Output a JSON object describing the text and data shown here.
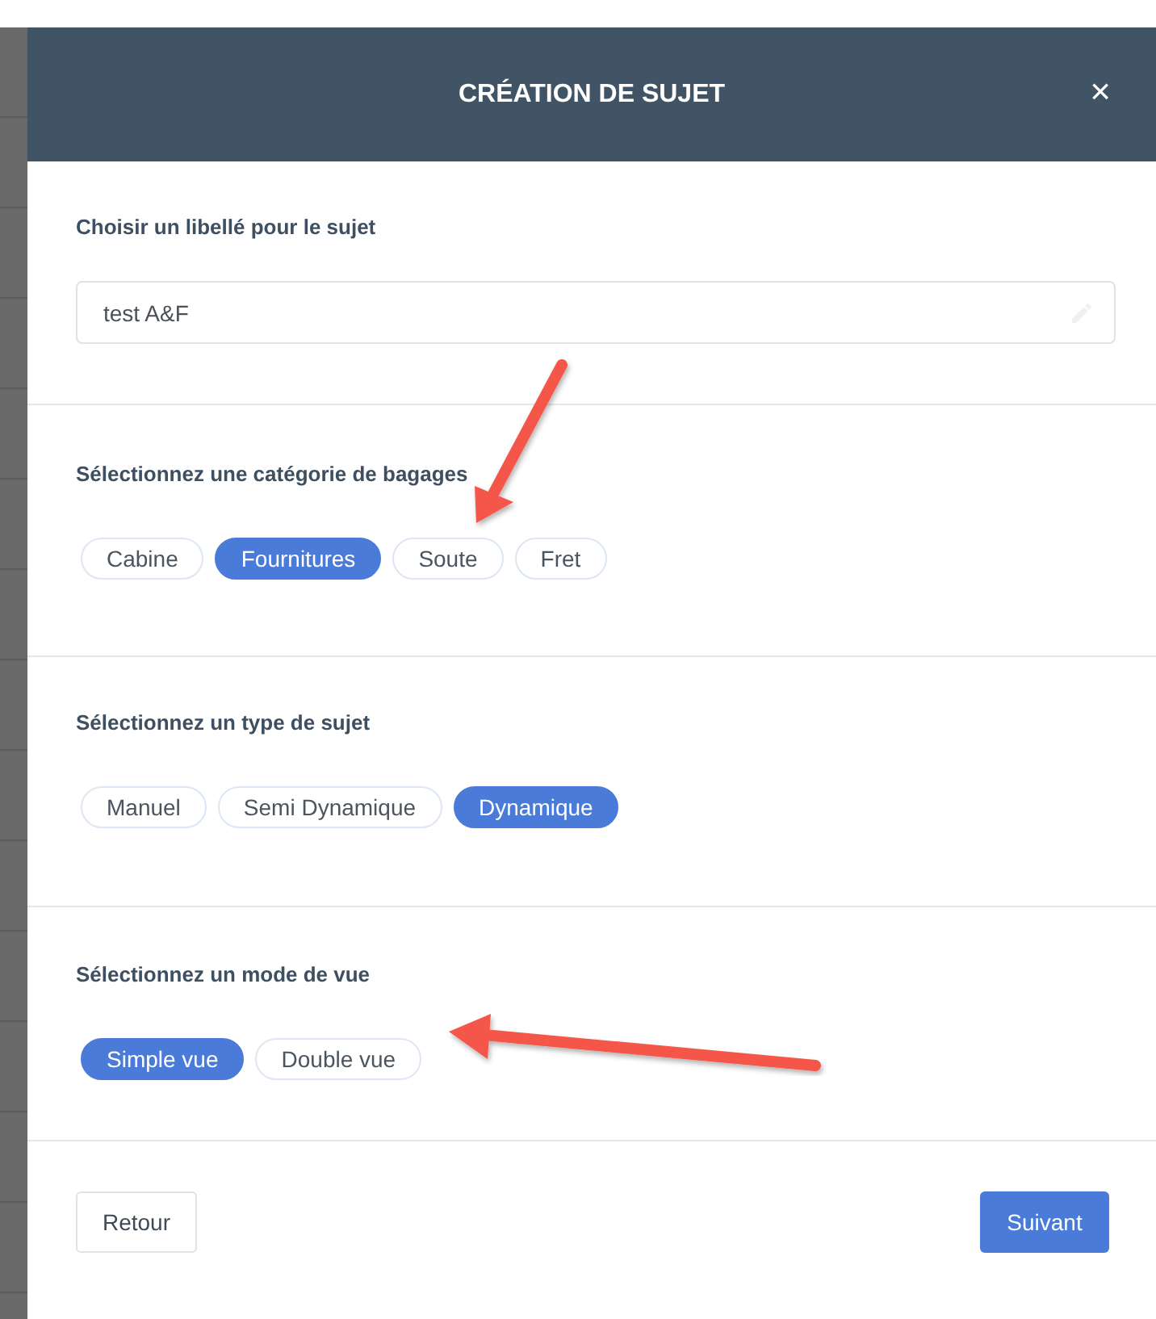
{
  "dialog": {
    "title": "CRÉATION DE SUJET",
    "close_icon": "×"
  },
  "name_field": {
    "label": "Choisir un libellé pour le sujet",
    "value": "test A&F"
  },
  "groups": [
    {
      "label": "Sélectionnez une catégorie de bagages",
      "options": [
        {
          "label": "Cabine",
          "selected": false
        },
        {
          "label": "Fournitures",
          "selected": true
        },
        {
          "label": "Soute",
          "selected": false
        },
        {
          "label": "Fret",
          "selected": false
        }
      ]
    },
    {
      "label": "Sélectionnez un type de sujet",
      "options": [
        {
          "label": "Manuel",
          "selected": false
        },
        {
          "label": "Semi Dynamique",
          "selected": false
        },
        {
          "label": "Dynamique",
          "selected": true
        }
      ]
    },
    {
      "label": "Sélectionnez un mode de vue",
      "options": [
        {
          "label": "Simple vue",
          "selected": true
        },
        {
          "label": "Double vue",
          "selected": false
        }
      ]
    }
  ],
  "footer": {
    "back": "Retour",
    "next": "Suivant"
  }
}
